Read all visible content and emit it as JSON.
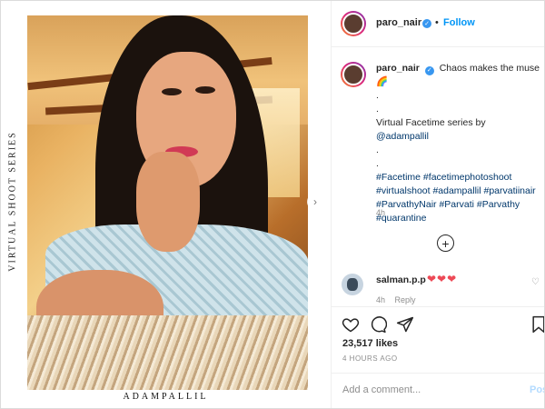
{
  "header": {
    "username": "paro_nair",
    "separator": "•",
    "follow_label": "Follow"
  },
  "image": {
    "side_text": "VIRTUAL SHOOT SERIES",
    "brand": "ADAMPALLIL",
    "next_icon": "chevron-right-icon"
  },
  "caption": {
    "username": "paro_nair",
    "lines": [
      "Chaos makes the muse",
      "🌈",
      ".",
      ".",
      "Virtual Facetime series by ",
      ".",
      ".",
      "#Facetime #facetimephotoshoot",
      "#virtualshoot #adampallil #parvatiinair",
      "#ParvathyNair #Parvati #Parvathy",
      "#quarantine"
    ],
    "mention": "@adampallil",
    "time": "4h"
  },
  "load_more_icon": "plus-circle-icon",
  "comment": {
    "username": "salman.p.p",
    "text": "❤❤❤",
    "time": "4h",
    "reply_label": "Reply",
    "like_icon": "heart-outline-icon"
  },
  "actions": {
    "like_icon": "heart-outline-icon",
    "comment_icon": "comment-icon",
    "share_icon": "share-icon",
    "save_icon": "bookmark-icon",
    "likes": "23,517 likes",
    "posted": "4 HOURS AGO"
  },
  "add_comment": {
    "placeholder": "Add a comment...",
    "post_label": "Post"
  },
  "colors": {
    "accent": "#0095f6",
    "verified": "#3897f0",
    "heart": "#ed4956",
    "muted": "#8e8e8e"
  }
}
